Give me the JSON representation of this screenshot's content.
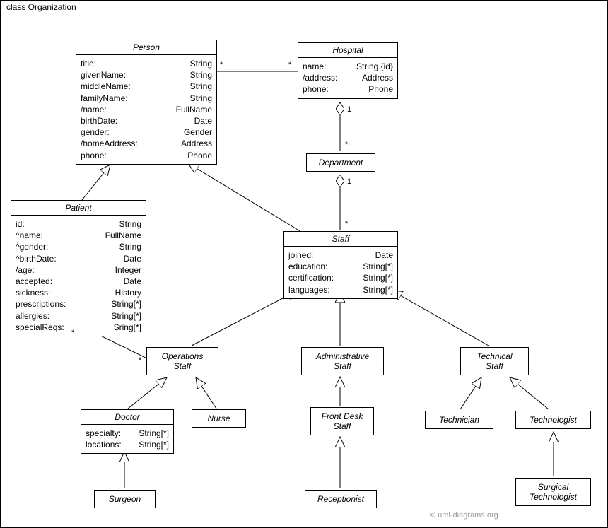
{
  "frame": {
    "title": "class Organization"
  },
  "watermark": "© uml-diagrams.org",
  "mult": {
    "person_hospital_l": "*",
    "person_hospital_r": "*",
    "hospital_dept": "1",
    "dept_top": "*",
    "dept_staff": "1",
    "staff_top": "*",
    "patient_ops_l": "*",
    "patient_ops_r": "*"
  },
  "classes": {
    "person": {
      "name": "Person",
      "attrs": [
        [
          "title:",
          "String"
        ],
        [
          "givenName:",
          "String"
        ],
        [
          "middleName:",
          "String"
        ],
        [
          "familyName:",
          "String"
        ],
        [
          "/name:",
          "FullName"
        ],
        [
          "birthDate:",
          "Date"
        ],
        [
          "gender:",
          "Gender"
        ],
        [
          "/homeAddress:",
          "Address"
        ],
        [
          "phone:",
          "Phone"
        ]
      ]
    },
    "hospital": {
      "name": "Hospital",
      "attrs": [
        [
          "name:",
          "String {id}"
        ],
        [
          "/address:",
          "Address"
        ],
        [
          "phone:",
          "Phone"
        ]
      ]
    },
    "department": {
      "name": "Department"
    },
    "patient": {
      "name": "Patient",
      "attrs": [
        [
          "id:",
          "String"
        ],
        [
          "^name:",
          "FullName"
        ],
        [
          "^gender:",
          "String"
        ],
        [
          "^birthDate:",
          "Date"
        ],
        [
          "/age:",
          "Integer"
        ],
        [
          "accepted:",
          "Date"
        ],
        [
          "sickness:",
          "History"
        ],
        [
          "prescriptions:",
          "String[*]"
        ],
        [
          "allergies:",
          "String[*]"
        ],
        [
          "specialReqs:",
          "Sring[*]"
        ]
      ]
    },
    "staff": {
      "name": "Staff",
      "attrs": [
        [
          "joined:",
          "Date"
        ],
        [
          "education:",
          "String[*]"
        ],
        [
          "certification:",
          "String[*]"
        ],
        [
          "languages:",
          "String[*]"
        ]
      ]
    },
    "ops": {
      "name": "Operations",
      "name2": "Staff"
    },
    "admin": {
      "name": "Administrative",
      "name2": "Staff"
    },
    "tech": {
      "name": "Technical",
      "name2": "Staff"
    },
    "doctor": {
      "name": "Doctor",
      "attrs": [
        [
          "specialty:",
          "String[*]"
        ],
        [
          "locations:",
          "String[*]"
        ]
      ]
    },
    "nurse": {
      "name": "Nurse"
    },
    "frontdesk": {
      "name": "Front Desk",
      "name2": "Staff"
    },
    "technician": {
      "name": "Technician"
    },
    "technologist": {
      "name": "Technologist"
    },
    "surgeon": {
      "name": "Surgeon"
    },
    "receptionist": {
      "name": "Receptionist"
    },
    "surgtech": {
      "name": "Surgical",
      "name2": "Technologist"
    }
  }
}
